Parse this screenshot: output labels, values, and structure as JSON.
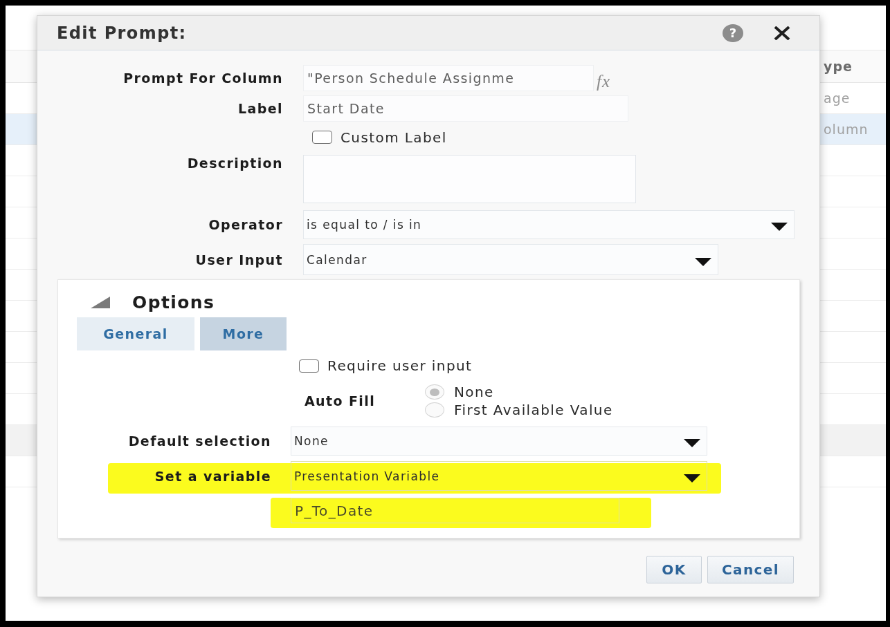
{
  "background_table": {
    "header": "ype",
    "rows": [
      {
        "text": "age",
        "selected": false
      },
      {
        "text": "olumn",
        "selected": true
      }
    ]
  },
  "dialog": {
    "title": "Edit Prompt:",
    "help_button": "?",
    "fields": [
      {
        "kind": "formula",
        "label": "Prompt For Column",
        "value": "\"Person Schedule Assignme",
        "button": "fx"
      },
      {
        "kind": "text",
        "label": "Label",
        "value": "Start Date"
      },
      {
        "kind": "checkbox",
        "label": "Custom Label",
        "checked": false
      },
      {
        "kind": "textarea",
        "label": "Description"
      },
      {
        "kind": "dropdown",
        "label": "Operator",
        "value": "is equal to / is in"
      },
      {
        "kind": "dropdown",
        "label": "User Input",
        "value": "Calendar"
      }
    ],
    "options": {
      "title": "Options",
      "expanded": true,
      "tabs": [
        {
          "label": "General",
          "selected": false
        },
        {
          "label": "More",
          "selected": true
        }
      ],
      "require_user_input": {
        "label": "Require user input",
        "checked": false
      },
      "auto_fill": {
        "label": "Auto Fill",
        "options": [
          {
            "label": "None",
            "selected": true
          },
          {
            "label": "First Available Value",
            "selected": false
          }
        ]
      },
      "default_selection": {
        "label": "Default selection",
        "value": "None",
        "highlighted": false
      },
      "set_variable": {
        "label": "Set a variable",
        "value": "Presentation Variable",
        "highlighted": true
      },
      "variable_name": {
        "value": "P_To_Date",
        "highlighted": true
      }
    },
    "buttons": [
      "OK",
      "Cancel"
    ]
  }
}
